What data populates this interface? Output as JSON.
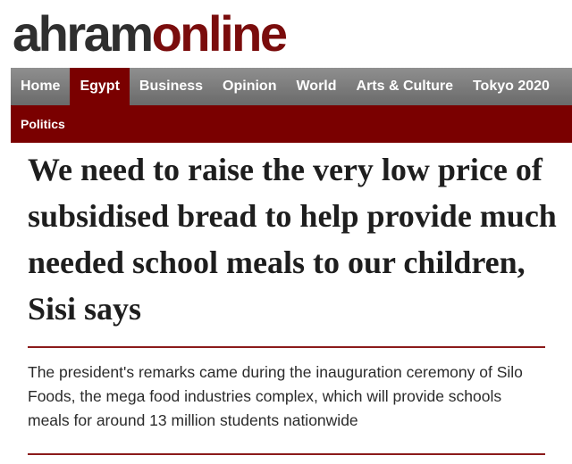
{
  "logo": {
    "part1": "ahram",
    "part2": "online"
  },
  "nav": {
    "items": [
      {
        "label": "Home"
      },
      {
        "label": "Egypt"
      },
      {
        "label": "Business"
      },
      {
        "label": "Opinion"
      },
      {
        "label": "World"
      },
      {
        "label": "Arts & Culture"
      },
      {
        "label": "Tokyo 2020"
      }
    ],
    "active": "Egypt"
  },
  "subnav": {
    "items": [
      {
        "label": "Politics"
      }
    ]
  },
  "article": {
    "headline": "We need to raise the very low price of subsidised bread to help provide much needed school meals to our children, Sisi says",
    "lead": "The president's remarks came during the inauguration ceremony of Silo Foods, the mega food industries complex, which will provide schools meals for around 13 million students nationwide"
  },
  "colors": {
    "brand": "#7a0000",
    "logo_dark": "#2f2f2f",
    "nav_gray": "#7d7d7d"
  }
}
